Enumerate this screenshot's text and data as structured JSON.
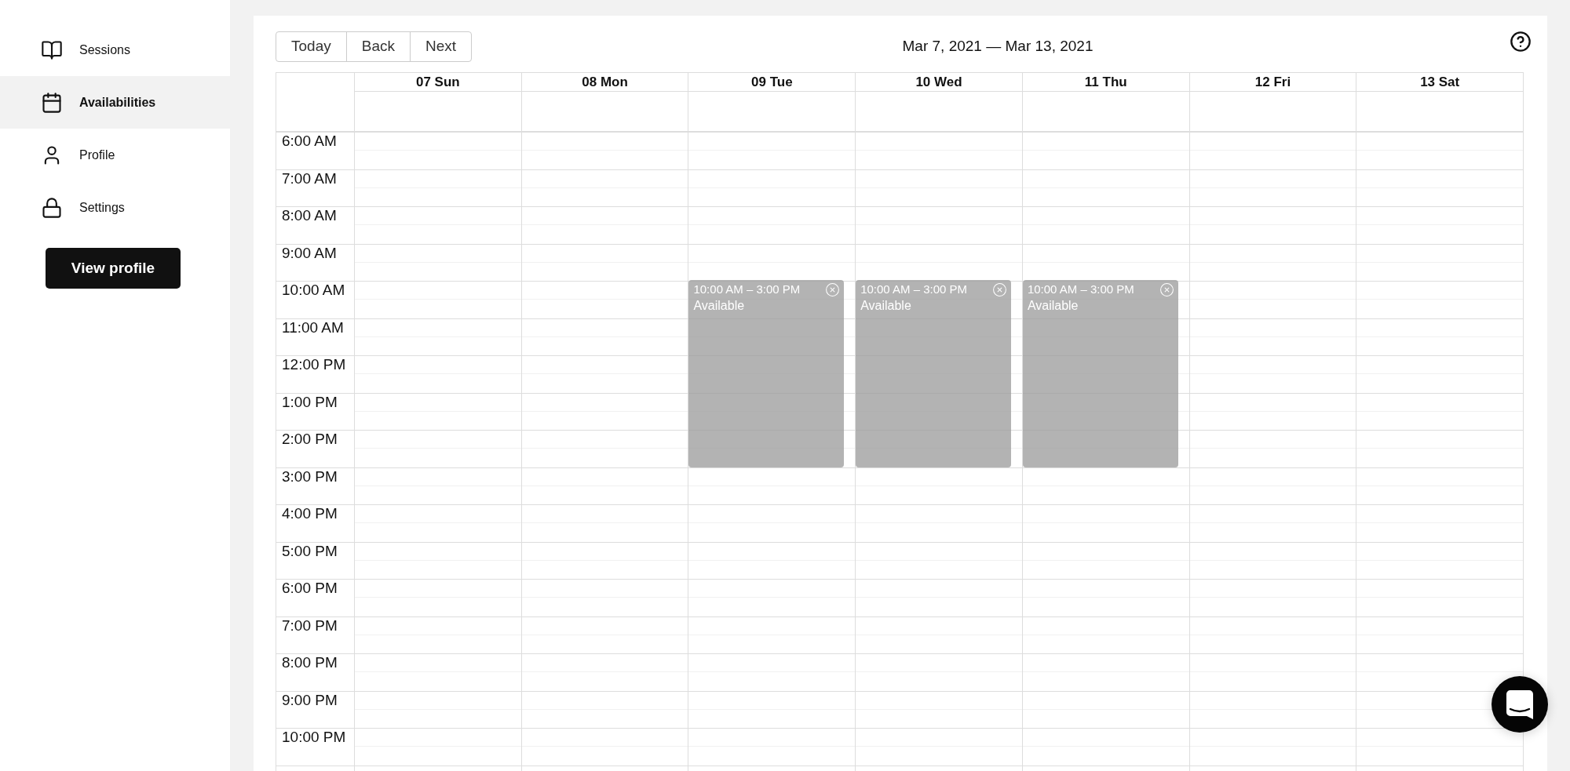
{
  "sidebar": {
    "items": [
      {
        "label": "Sessions",
        "selected": false
      },
      {
        "label": "Availabilities",
        "selected": true
      },
      {
        "label": "Profile",
        "selected": false
      },
      {
        "label": "Settings",
        "selected": false
      }
    ],
    "button": "View profile"
  },
  "toolbar": {
    "buttons": [
      "Today",
      "Back",
      "Next"
    ],
    "date_range": "Mar 7, 2021 — Mar 13, 2021"
  },
  "calendar": {
    "days": [
      {
        "label": "07 Sun"
      },
      {
        "label": "08 Mon"
      },
      {
        "label": "09 Tue",
        "events": [
          {
            "time": "10:00 AM – 3:00 PM",
            "title": "Available"
          }
        ]
      },
      {
        "label": "10 Wed",
        "events": [
          {
            "time": "10:00 AM – 3:00 PM",
            "title": "Available"
          }
        ]
      },
      {
        "label": "11 Thu",
        "events": [
          {
            "time": "10:00 AM – 3:00 PM",
            "title": "Available"
          }
        ]
      },
      {
        "label": "12 Fri"
      },
      {
        "label": "13 Sat"
      }
    ],
    "times": [
      "6:00 AM",
      "7:00 AM",
      "8:00 AM",
      "9:00 AM",
      "10:00 AM",
      "11:00 AM",
      "12:00 PM",
      "1:00 PM",
      "2:00 PM",
      "3:00 PM",
      "4:00 PM",
      "5:00 PM",
      "6:00 PM",
      "7:00 PM",
      "8:00 PM",
      "9:00 PM",
      "10:00 PM"
    ]
  }
}
